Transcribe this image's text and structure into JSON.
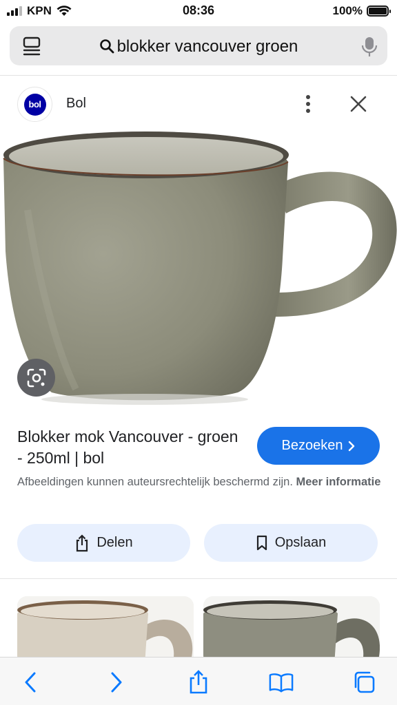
{
  "status": {
    "carrier": "KPN",
    "time": "08:36",
    "battery_percent": "100%",
    "battery_level": 1.0,
    "signal_bars": 3
  },
  "address_bar": {
    "query": "blokker vancouver groen",
    "icons": [
      "tabs-overview-icon",
      "search-icon",
      "microphone-icon"
    ]
  },
  "source": {
    "logo_text": "bol",
    "name": "Bol",
    "icons": [
      "more-vertical-icon",
      "close-icon"
    ]
  },
  "product": {
    "title": "Blokker mok Vancouver - groen - 250ml | bol",
    "visit_label": "Bezoeken",
    "copyright_text": "Afbeeldingen kunnen auteursrechtelijk beschermd zijn.",
    "more_info_label": "Meer informatie",
    "share_label": "Delen",
    "save_label": "Opslaan",
    "image_icon": "lens-icon"
  },
  "colors": {
    "accent": "#1a73e8",
    "action_bg": "#e8f0fe",
    "brand_bol": "#0000a4",
    "mug_green": "#8a8a78",
    "toolbar_icon": "#0a7aff"
  },
  "toolbar": {
    "icons": [
      "back-icon",
      "forward-icon",
      "share-icon",
      "bookmarks-icon",
      "tabs-icon"
    ]
  }
}
